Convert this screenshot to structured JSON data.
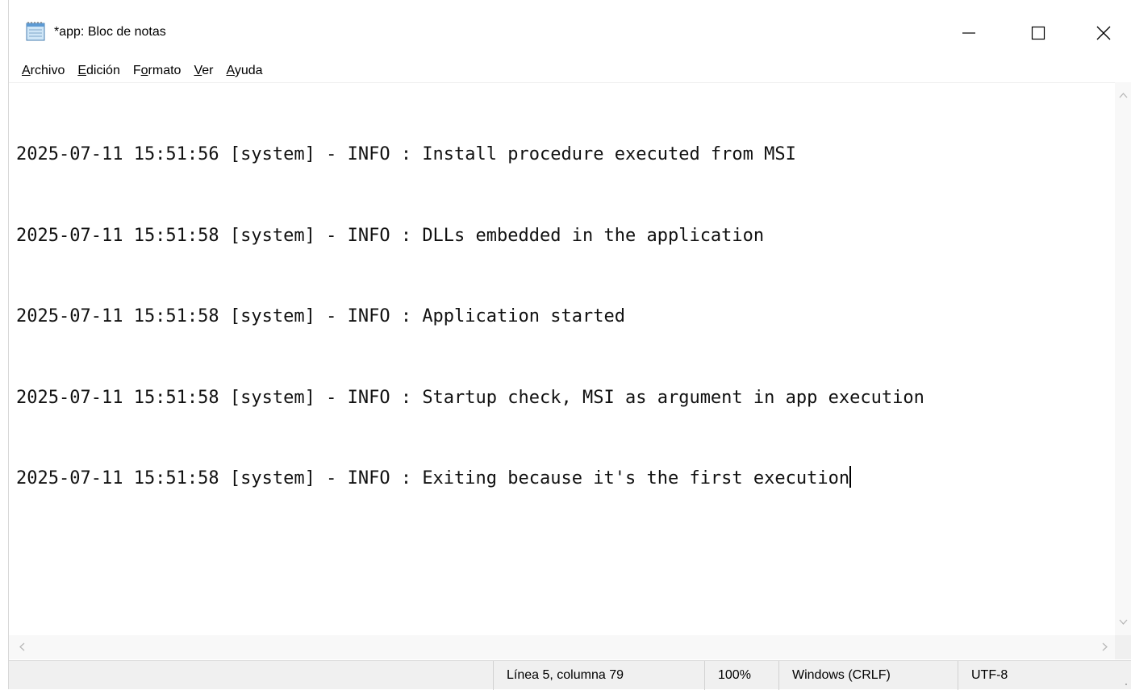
{
  "window": {
    "title": "*app: Bloc de notas",
    "icon": "notepad-icon"
  },
  "controls": {
    "minimize_icon": "minimize-icon",
    "maximize_icon": "maximize-icon",
    "close_icon": "close-icon"
  },
  "menu": [
    {
      "accel": "A",
      "rest": "rchivo"
    },
    {
      "accel": "E",
      "rest": "dición"
    },
    {
      "pre": "F",
      "accel": "o",
      "rest": "rmato"
    },
    {
      "accel": "V",
      "rest": "er"
    },
    {
      "accel": "A",
      "rest": "yuda"
    }
  ],
  "editor": {
    "lines": [
      "2025-07-11 15:51:56 [system] - INFO : Install procedure executed from MSI",
      "2025-07-11 15:51:58 [system] - INFO : DLLs embedded in the application",
      "2025-07-11 15:51:58 [system] - INFO : Application started",
      "2025-07-11 15:51:58 [system] - INFO : Startup check, MSI as argument in app execution",
      "2025-07-11 15:51:58 [system] - INFO : Exiting because it's the first execution"
    ]
  },
  "status": {
    "position": "Línea 5, columna 79",
    "zoom": "100%",
    "line_endings": "Windows (CRLF)",
    "encoding": "UTF-8"
  },
  "colors": {
    "status_bg": "#f0f0f0",
    "scrollbar_bg": "#f8f8f8"
  }
}
